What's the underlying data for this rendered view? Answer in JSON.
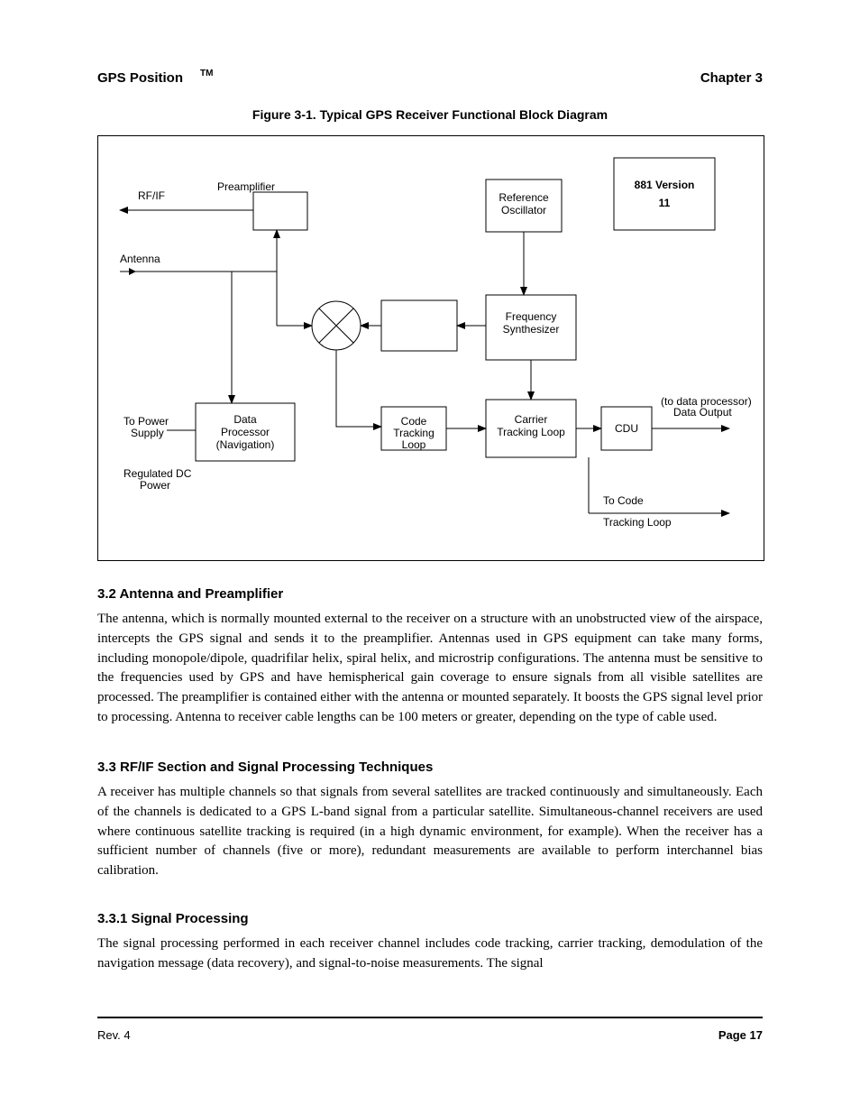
{
  "header": {
    "left": "GPS Position",
    "tm": "TM",
    "right": "Chapter 3"
  },
  "figure": {
    "title": "Figure 3-1. Typical GPS Receiver Functional Block Diagram",
    "version_box": "881 Version\n11",
    "labels": {
      "rf_if": "RF/IF",
      "preamp": "Preamplifier",
      "antenna_in": "Antenna",
      "reference_osc": "Reference\nOscillator",
      "frequency_synth": "Frequency\nSynthesizer",
      "data_proc_nav": "Data\nProcessor\n(Navigation)",
      "code_tracking": "Code Tracking\nLoop",
      "carrier_tracking": "Carrier\nTracking Loop",
      "cdu": "CDU",
      "to_power": "To Power\nSupply",
      "power_in": "Regulated DC\nPower",
      "out_top": "Data Output\n(to data processor)",
      "out_bot": "To Code\nTracking Loop"
    }
  },
  "sections": {
    "s32": {
      "h": "3.2   Antenna and Preamplifier",
      "p": "The antenna, which is normally mounted external to the receiver on a structure with an unobstructed view of the airspace, intercepts the GPS signal and sends it to the preamplifier. Antennas used in GPS equipment can take many forms, including monopole/dipole, quadrifilar helix, spiral helix, and microstrip configurations. The antenna must be sensitive to the frequencies used by GPS and have hemispherical gain coverage to ensure signals from all visible satellites are processed. The preamplifier is contained either with the antenna or mounted separately. It boosts the GPS signal level prior to processing. Antenna to receiver cable lengths can be 100 meters or greater, depending on the type of cable used."
    },
    "s33": {
      "h": "3.3   RF/IF Section and Signal Processing Techniques",
      "p": "A receiver has multiple channels so that signals from several satellites are tracked continuously and simultaneously. Each of the channels is dedicated to a GPS L-band signal from a particular satellite. Simultaneous-channel receivers are used where continuous satellite tracking is required (in a high dynamic environment, for example). When the receiver has a sufficient number of channels (five or more), redundant measurements are available to perform interchannel bias calibration."
    },
    "s331": {
      "h": "3.3.1   Signal Processing",
      "p": "The signal processing performed in each receiver channel includes code tracking, carrier tracking, demodulation of the navigation message (data recovery), and signal-to-noise measurements. The signal"
    }
  },
  "footer": {
    "left": "Rev. 4",
    "right": "Page 17"
  }
}
